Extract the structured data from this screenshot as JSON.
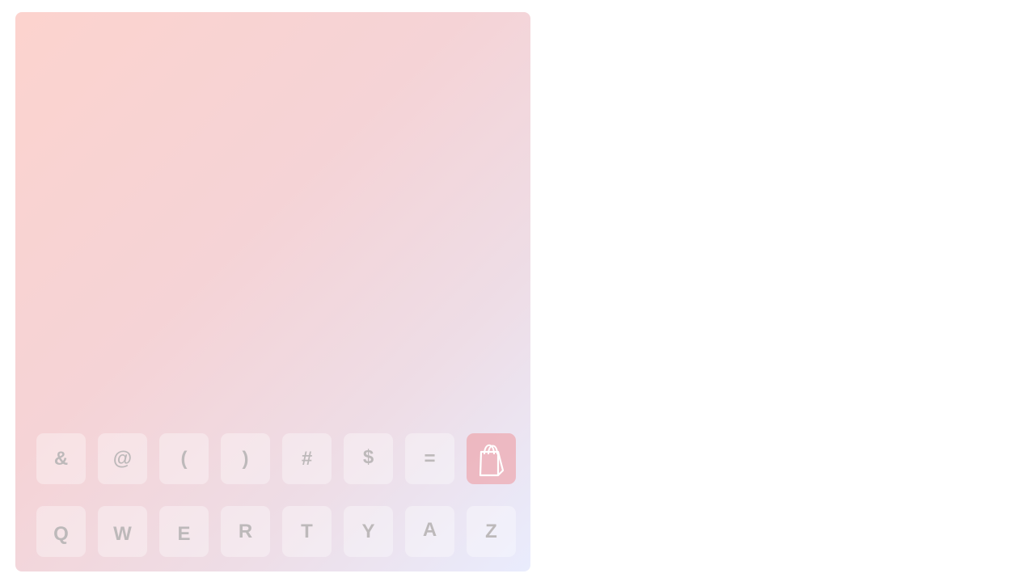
{
  "keyboard": {
    "row1": [
      "&",
      "@",
      "(",
      ")",
      "#",
      "$",
      "="
    ],
    "row2": [
      "Q",
      "W",
      "E",
      "R",
      "T",
      "Y",
      "A",
      "Z"
    ],
    "action_icon": "shopping-bag-icon"
  },
  "colors": {
    "key_text": "#bdb9ba",
    "bag_key_bg": "#f0a9ad"
  }
}
